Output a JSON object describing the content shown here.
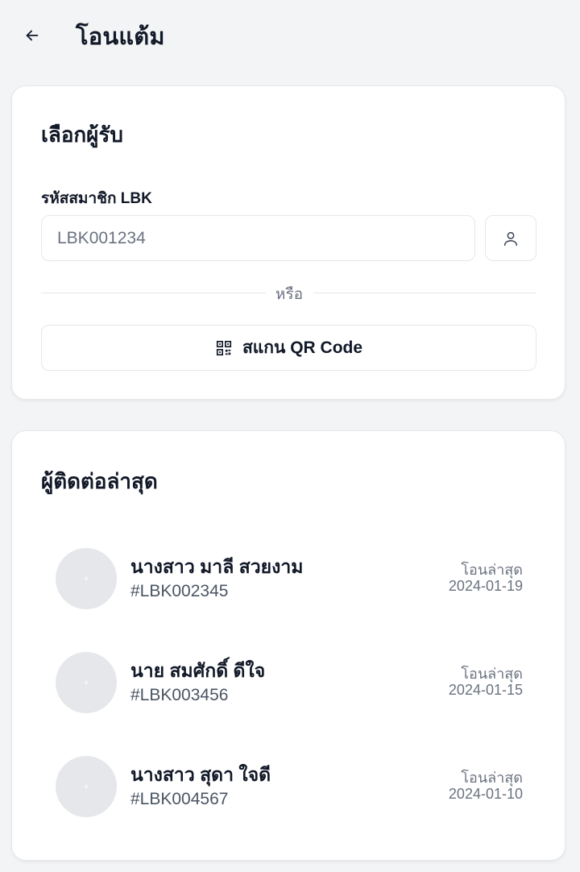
{
  "header": {
    "title": "โอนแต้ม",
    "back_icon": "arrow-left-icon"
  },
  "recipient": {
    "title": "เลือกผู้รับ",
    "member_label": "รหัสสมาชิก LBK",
    "member_placeholder": "LBK001234",
    "contact_icon": "user-icon",
    "or_text": "หรือ",
    "scan_label": "สแกน QR Code",
    "scan_icon": "qr-code-icon"
  },
  "recent": {
    "title": "ผู้ติดต่อล่าสุด",
    "contacts": [
      {
        "name": "นางสาว มาลี สวยงาม",
        "id": "#LBK002345",
        "last_label": "โอนล่าสุด",
        "last_date": "2024-01-19"
      },
      {
        "name": "นาย สมศักดิ์ ดีใจ",
        "id": "#LBK003456",
        "last_label": "โอนล่าสุด",
        "last_date": "2024-01-15"
      },
      {
        "name": "นางสาว สุดา ใจดี",
        "id": "#LBK004567",
        "last_label": "โอนล่าสุด",
        "last_date": "2024-01-10"
      }
    ]
  },
  "colors": {
    "background": "#f3f4f6",
    "card": "#ffffff",
    "border": "#e5e7eb",
    "text": "#111827",
    "muted": "#6b7280"
  }
}
